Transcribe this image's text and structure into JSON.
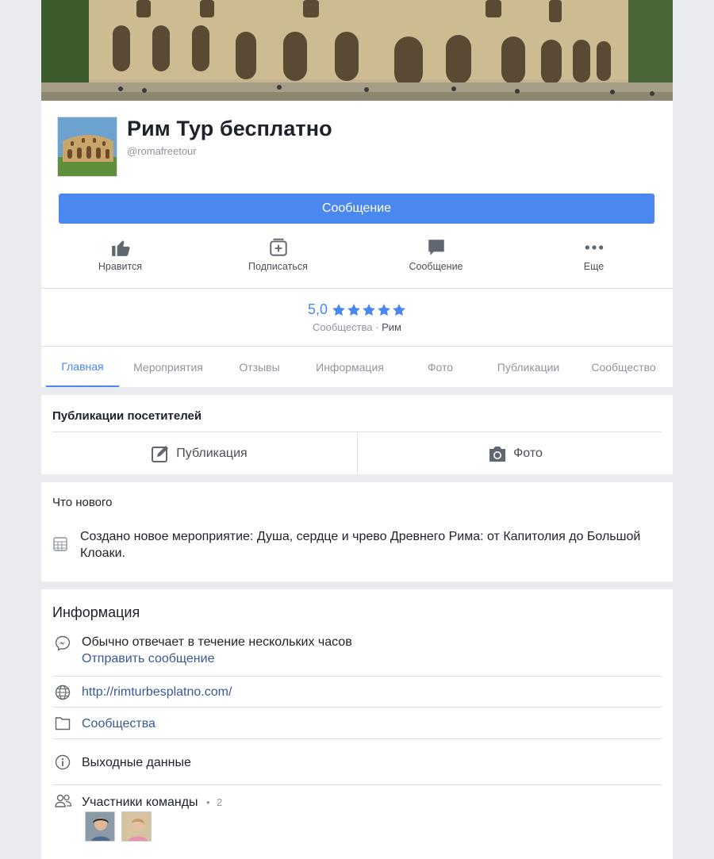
{
  "page": {
    "title": "Рим Тур бесплатно",
    "handle": "@romafreetour",
    "message_button": "Сообщение"
  },
  "actions": [
    {
      "label": "Нравится",
      "icon": "thumbs-up-icon"
    },
    {
      "label": "Подписаться",
      "icon": "follow-inbox-icon"
    },
    {
      "label": "Сообщение",
      "icon": "chat-bubble-icon"
    },
    {
      "label": "Еще",
      "icon": "more-dots-icon"
    }
  ],
  "rating": {
    "value": "5,0",
    "stars": 5,
    "category": "Сообщества",
    "separator": "·",
    "city": "Рим"
  },
  "tabs": [
    "Главная",
    "Мероприятия",
    "Отзывы",
    "Информация",
    "Фото",
    "Публикации",
    "Сообщество"
  ],
  "visitor_posts": {
    "title": "Публикации посетителей",
    "post_label": "Публикация",
    "photo_label": "Фото"
  },
  "whats_new": {
    "title": "Что нового",
    "item": "Создано новое мероприятие: Душа, сердце и чрево Древнего Рима: от Капитолия до Большой Клоаки."
  },
  "info": {
    "title": "Информация",
    "response_time": "Обычно отвечает в течение нескольких часов",
    "send_message": "Отправить сообщение",
    "website": "http://rimturbesplatno.com/",
    "category": "Сообщества",
    "imprint": "Выходные данные",
    "team_label": "Участники команды",
    "team_dot": "•",
    "team_count": "2"
  },
  "colors": {
    "accent": "#4a87ee",
    "link": "#385898",
    "background": "#e9ebee"
  }
}
